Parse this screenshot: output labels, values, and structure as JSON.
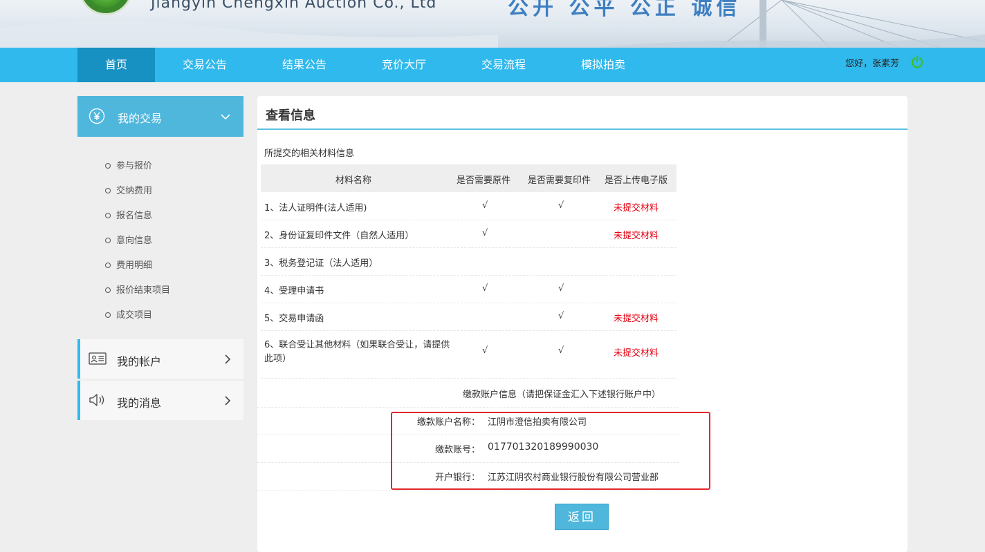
{
  "header": {
    "company_en": "Jiangyin Chengxin Auction Co., Ltd",
    "slogan": "公开  公平  公正  诚信"
  },
  "nav": {
    "items": [
      "首页",
      "交易公告",
      "结果公告",
      "竞价大厅",
      "交易流程",
      "模拟拍卖"
    ],
    "active": "首页",
    "greeting": "您好，张素芳",
    "power_icon": "power-icon",
    "bg_color": "#30b9ec",
    "active_color": "#1791c2"
  },
  "sidebar": {
    "my_trade": {
      "label": "我的交易",
      "icon": "yen-icon"
    },
    "sub_items": [
      "参与报价",
      "交纳费用",
      "报名信息",
      "意向信息",
      "费用明细",
      "报价结束项目",
      "成交项目"
    ],
    "my_account": {
      "label": "我的帐户",
      "icon": "id-card-icon"
    },
    "my_messages": {
      "label": "我的消息",
      "icon": "speaker-icon"
    }
  },
  "main": {
    "title": "查看信息",
    "section_title": "所提交的相关材料信息",
    "table": {
      "headers": [
        "材料名称",
        "是否需要原件",
        "是否需要复印件",
        "是否上传电子版"
      ],
      "rows": [
        {
          "name": "1、法人证明件(法人适用)",
          "original": "√",
          "copy": "√",
          "upload": "未提交材料"
        },
        {
          "name": "2、身份证复印件文件（自然人适用）",
          "original": "√",
          "copy": "",
          "upload": "未提交材料"
        },
        {
          "name": "3、税务登记证（法人适用）",
          "original": "",
          "copy": "",
          "upload": ""
        },
        {
          "name": "4、受理申请书",
          "original": "√",
          "copy": "√",
          "upload": ""
        },
        {
          "name": "5、交易申请函",
          "original": "",
          "copy": "√",
          "upload": "未提交材料"
        },
        {
          "name": "6、联合受让其他材料（如果联合受让，请提供此项）",
          "original": "√",
          "copy": "√",
          "upload": "未提交材料"
        }
      ]
    },
    "payment": {
      "title": "缴款账户信息（请把保证金汇入下述银行账户中）",
      "account_name_label": "缴款账户名称：",
      "account_name": "江阴市澄信拍卖有限公司",
      "account_no_label": "缴款账号：",
      "account_no": "017701320189990030",
      "bank_label": "开户银行：",
      "bank": "江苏江阴农村商业银行股份有限公司营业部"
    },
    "back_button": "返回",
    "highlight_color": "#e4262b",
    "status_color": "#e60012"
  }
}
